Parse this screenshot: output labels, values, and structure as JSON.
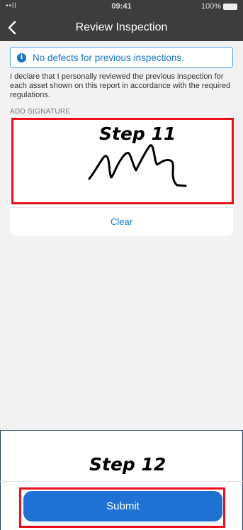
{
  "status_bar": {
    "time": "09:41",
    "signal": "••ll",
    "battery": "100%"
  },
  "nav": {
    "title": "Review Inspection"
  },
  "info_banner": {
    "text": "No defects for previous inspections."
  },
  "declaration_text": "I declare that I personally reviewed the previous inspection for each asset shown on this report in accordance with the required regulations.",
  "signature": {
    "label": "ADD SIGNATURE",
    "clear_label": "Clear"
  },
  "annotations": {
    "step11": "Step 11",
    "step12": "Step 12"
  },
  "submit_label": "Submit",
  "colors": {
    "accent": "#1a73c7",
    "submit": "#1f72d3",
    "highlight": "#e8101c",
    "header": "#3d3d3d"
  }
}
